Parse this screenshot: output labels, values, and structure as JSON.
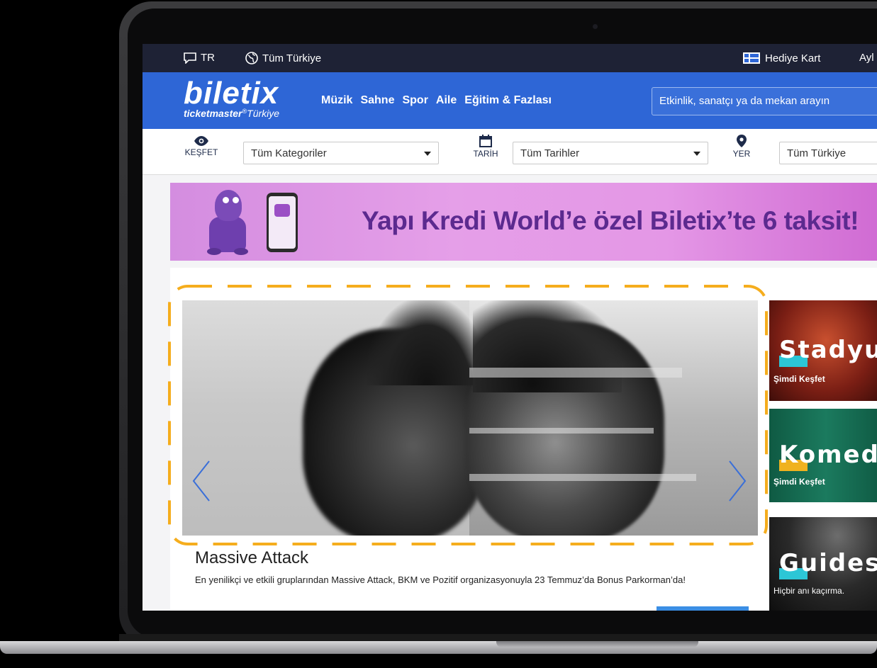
{
  "topbar": {
    "language": "TR",
    "region": "Tüm Türkiye",
    "gift_card": "Hediye Kart",
    "account_partial": "Ayl"
  },
  "header": {
    "logo_main": "biletix",
    "logo_sub_brand": "ticketmaster",
    "logo_sub_region": "Türkiye",
    "nav": [
      "Müzik",
      "Sahne",
      "Spor",
      "Aile",
      "Eğitim & Fazlası"
    ],
    "search_placeholder": "Etkinlik, sanatçı ya da mekan arayın"
  },
  "filters": {
    "discover_label": "KEŞFET",
    "category_value": "Tüm Kategoriler",
    "date_label": "TARİH",
    "date_value": "Tüm Tarihler",
    "place_label": "YER",
    "place_value": "Tüm Türkiye"
  },
  "banner": {
    "text": "Yapı Kredi World’e özel Biletix’te 6 taksit!"
  },
  "hero": {
    "title": "Massive Attack",
    "description": "En yenilikçi ve etkili gruplarından Massive Attack, BKM ve Pozitif organizasyonuyla 23 Temmuz’da Bonus Parkorman’da!"
  },
  "promos": [
    {
      "title": "Stadyum",
      "subtitle": "Şimdi Keşfet",
      "bg": "#8a2a1e",
      "highlight": "#2cc6d6"
    },
    {
      "title": "Komedi",
      "subtitle": "Şimdi Keşfet",
      "bg": "#1b6b52",
      "highlight": "#f0b21f"
    },
    {
      "title": "Guides",
      "subtitle": "Hiçbir anı kaçırma.",
      "bg": "#151515",
      "highlight": "#2cc6d6"
    }
  ],
  "colors": {
    "topbar": "#1e2235",
    "header": "#2e66d6",
    "highlight_dashes": "#f5ad1d",
    "carousel_arrow": "#3a6fd8"
  }
}
